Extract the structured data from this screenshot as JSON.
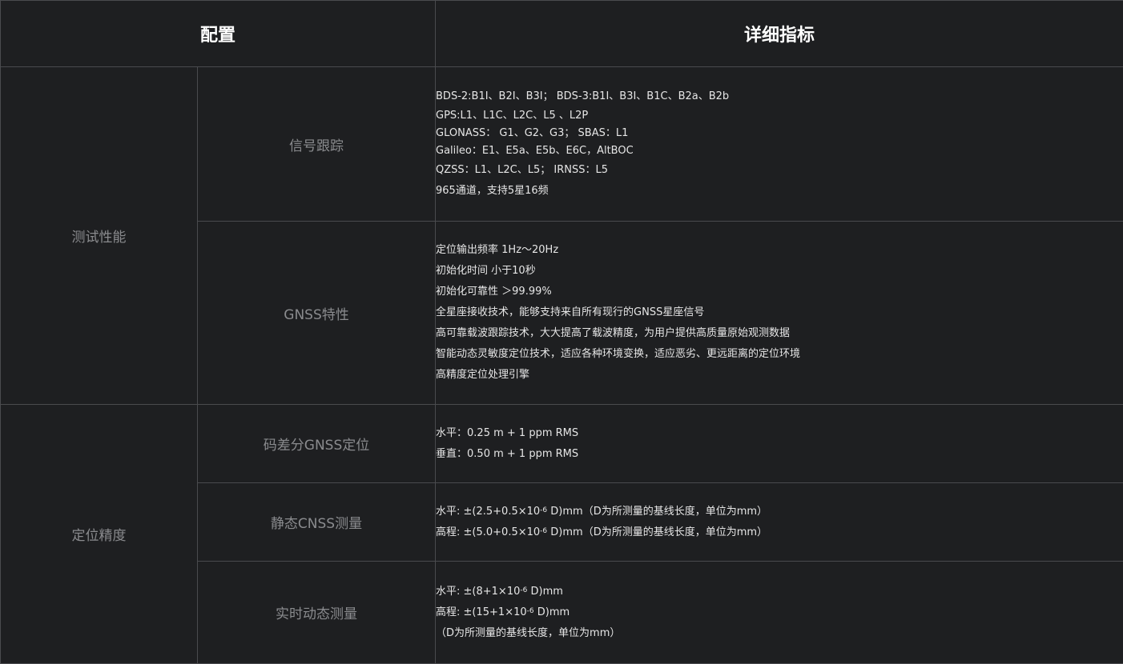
{
  "header": {
    "config": "配置",
    "detail": "详细指标"
  },
  "categories": {
    "test": "测试性能",
    "accuracy": "定位精度"
  },
  "rows": {
    "signal": {
      "label": "信号跟踪",
      "lines": [
        "BDS-2:B1I、B2I、B3I； BDS-3:B1I、B3I、B1C、B2a、B2b",
        "GPS:L1、L1C、L2C、L5 、L2P",
        "GLONASS： G1、G2、G3； SBAS：L1",
        "Galileo：E1、E5a、E5b、E6C，AltBOC",
        "QZSS：L1、L2C、L5； IRNSS：L5",
        "965通道，支持5星16频"
      ]
    },
    "gnss": {
      "label": "GNSS特性",
      "lines": [
        "定位输出频率 1Hz～20Hz",
        "初始化时间 小于10秒",
        "初始化可靠性 ＞99.99%",
        "全星座接收技术，能够支持来自所有现行的GNSS星座信号",
        "高可靠载波跟踪技术，大大提高了载波精度，为用户提供高质量原始观测数据",
        "智能动态灵敏度定位技术，适应各种环境变换，适应恶劣、更远距离的定位环境",
        "高精度定位处理引擎"
      ]
    },
    "code": {
      "label": "码差分GNSS定位",
      "lines": [
        "水平：0.25 m + 1 ppm RMS",
        "垂直：0.50 m + 1 ppm RMS"
      ]
    },
    "static": {
      "label": "静态CNSS测量",
      "h_pre": "水平: ±(2.5+0.5×10",
      "h_exp": "-6",
      "h_post": " D)mm（D为所测量的基线长度，单位为mm）",
      "v_pre": "高程: ±(5.0+0.5×10",
      "v_exp": "-6",
      "v_post": " D)mm（D为所测量的基线长度，单位为mm）"
    },
    "rtk": {
      "label": "实时动态测量",
      "h_pre": "水平: ±(8+1×10",
      "h_exp": "-6",
      "h_post": " D)mm",
      "v_pre": "高程: ±(15+1×10",
      "v_exp": "-6",
      "v_post": " D)mm",
      "note": "（D为所测量的基线长度，单位为mm）"
    }
  }
}
